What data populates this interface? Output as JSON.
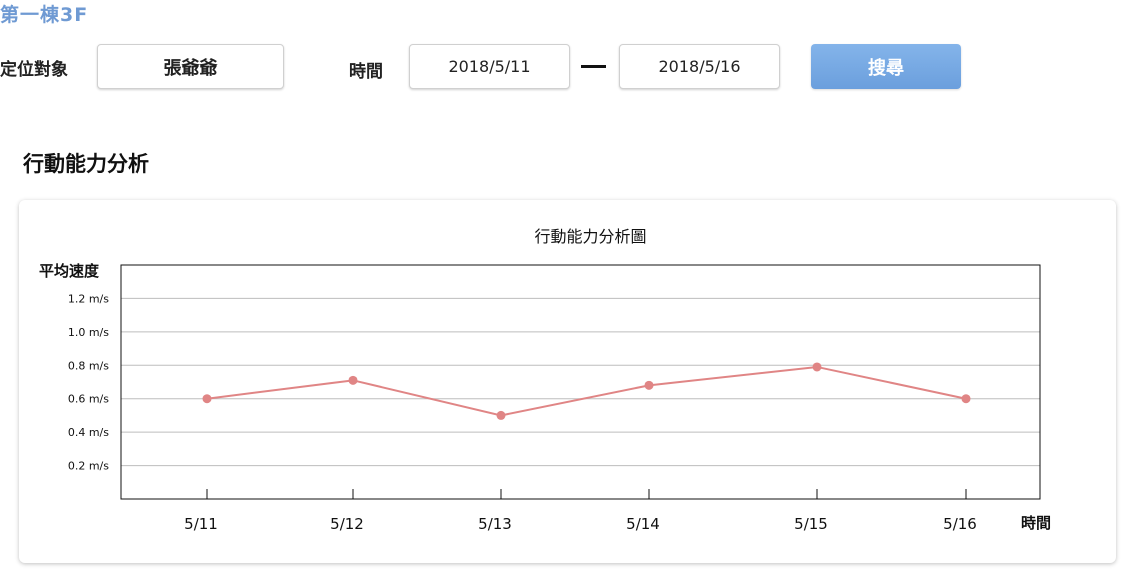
{
  "header": {
    "building": "第一棟3F"
  },
  "filters": {
    "target_label": "定位對象",
    "target_value": "張爺爺",
    "time_label": "時間",
    "date_from": "2018/5/11",
    "date_to": "2018/5/16",
    "search_label": "搜尋"
  },
  "section": {
    "title": "行動能力分析"
  },
  "colors": {
    "accent": "#6f9ad3",
    "series": "#e08585"
  },
  "chart_data": {
    "type": "line",
    "title": "行動能力分析圖",
    "ylabel": "平均速度",
    "xlabel": "時間",
    "categories": [
      "5/11",
      "5/12",
      "5/13",
      "5/14",
      "5/15",
      "5/16"
    ],
    "values": [
      0.6,
      0.71,
      0.5,
      0.68,
      0.79,
      0.6
    ],
    "y_ticks": [
      {
        "value": 0.2,
        "label": "0.2 m/s"
      },
      {
        "value": 0.4,
        "label": "0.4 m/s"
      },
      {
        "value": 0.6,
        "label": "0.6 m/s"
      },
      {
        "value": 0.8,
        "label": "0.8 m/s"
      },
      {
        "value": 1.0,
        "label": "1.0 m/s"
      },
      {
        "value": 1.2,
        "label": "1.2 m/s"
      }
    ],
    "ylim": [
      0,
      1.4
    ],
    "grid": true
  }
}
